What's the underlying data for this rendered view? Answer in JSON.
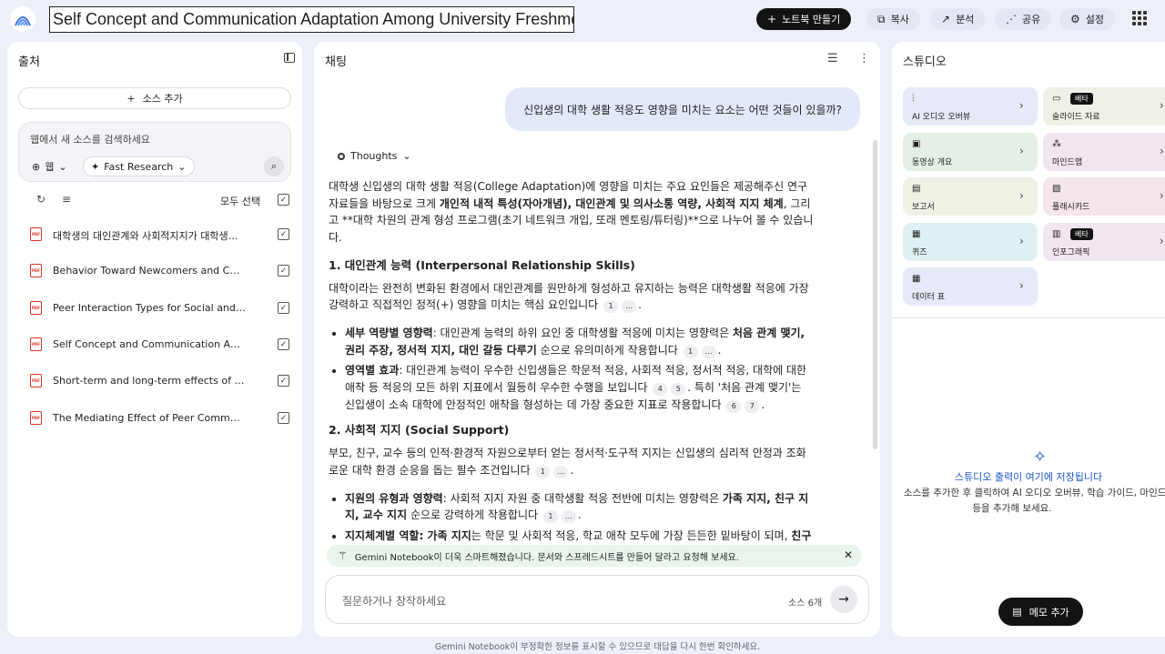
{
  "header": {
    "title": "Self Concept and Communication Adaptation Among University Freshmen",
    "create_notebook": "노트북 만들기",
    "copy": "복사",
    "analytics": "분석",
    "share": "공유",
    "settings": "설정"
  },
  "sources": {
    "panel_title": "출처",
    "add_source": "소스 추가",
    "search_placeholder": "웹에서 새 소스를 검색하세요",
    "chip_web": "웹",
    "chip_research": "Fast Research",
    "select_all": "모두 선택",
    "items": [
      "대학생의 대인관계와 사회적지지가 대학생활 적응에 미치는 영향",
      "Behavior Toward Newcomers and Contributions to Online Communities",
      "Peer Interaction Types for Social and Academic Adjustment",
      "Self Concept and Communication Adaptation Among University Freshmen",
      "Short-term and long-term effects of a social network intervention",
      "The Mediating Effect of Peer Communication on Adjustment"
    ]
  },
  "chat": {
    "panel_title": "채팅",
    "user_message": "신입생의 대학 생활 적응도 영향을 미치는 요소는 어떤 것들이 있을까?",
    "thoughts_label": "Thoughts",
    "intro_a": "대학생 신입생의 대학 생활 적응(College Adaptation)에 영향을 미치는 주요 요인들은 제공해주신 연구 자료들을 바탕으로 크게 ",
    "intro_b": "개인적 내적 특성(자아개념), 대인관계 및 의사소통 역량, 사회적 지지 체계",
    "intro_c": ", 그리고 **대학 차원의 관계 형성 프로그램(초기 네트워크 개입, 또래 멘토링/튜터링)**으로 나누어 볼 수 있습니다.",
    "s1_title": "1. 대인관계 능력 (Interpersonal Relationship Skills)",
    "s1_body": "대학이라는 완전히 변화된 환경에서 대인관계를 원만하게 형성하고 유지하는 능력은 대학생활 적응에 가장 강력하고 직접적인 정적(+) 영향을 미치는 핵심 요인입니다",
    "s1_b1_head": "세부 역량별 영향력",
    "s1_b1_a": ": 대인관계 능력의 하위 요인 중 대학생활 적응에 미치는 영향력은 ",
    "s1_b1_b": "처음 관계 맺기, 권리 주장, 정서적 지지, 대인 갈등 다루기",
    "s1_b1_c": " 순으로 유의미하게 작용합니다",
    "s1_b2_head": "영역별 효과",
    "s1_b2_a": ": 대인관계 능력이 우수한 신입생들은 학문적 적응, 사회적 적응, 정서적 적응, 대학에 대한 애착 등 적응의 모든 하위 지표에서 월등히 우수한 수행을 보입니다",
    "s1_b2_b": ". 특히 '처음 관계 맺기'는 신입생이 소속 대학에 안정적인 애착을 형성하는 데 가장 중요한 지표로 작용합니다",
    "s2_title": "2. 사회적 지지 (Social Support)",
    "s2_body": "부모, 친구, 교수 등의 인적·환경적 자원으로부터 얻는 정서적·도구적 지지는 신입생의 심리적 안정과 조화로운 대학 환경 순응을 돕는 필수 조건입니다",
    "s2_b1_head": "지원의 유형과 영향력",
    "s2_b1_a": ": 사회적 지지 자원 중 대학생활 적응 전반에 미치는 영향력은 ",
    "s2_b1_b": "가족 지지, 친구 지지, 교수 지지",
    "s2_b1_c": " 순으로 강력하게 작용합니다",
    "s2_b2_head": "지지체계별 역할: 가족 지지",
    "s2_b2_a": "는 학문 및 사회적 적응, 학교 애착 모두에 가장 든든한 밑바탕이 되며, ",
    "s2_b2_b": "친구",
    "cite_1": "1",
    "cite_more": "…",
    "cite_4": "4",
    "cite_5": "5",
    "cite_6": "6",
    "cite_7": "7",
    "banner": "Gemini Notebook이 더욱 스마트해졌습니다. 문서와 스프레드시트를 만들어 달라고 요청해 보세요.",
    "input_placeholder": "질문하거나 창작하세요",
    "source_count": "소스 6개"
  },
  "studio": {
    "panel_title": "스튜디오",
    "beta": "베타",
    "cards": [
      {
        "label": "AI 오디오 오버뷰",
        "color": "#e6e9f7"
      },
      {
        "label": "슬라이드 자료",
        "color": "#f1f0e6"
      },
      {
        "label": "동영상 개요",
        "color": "#e4f0e6"
      },
      {
        "label": "마인드맵",
        "color": "#f1e6ef"
      },
      {
        "label": "보고서",
        "color": "#f1f0e4"
      },
      {
        "label": "플래시카드",
        "color": "#f3e5ea"
      },
      {
        "label": "퀴즈",
        "color": "#dff0f3"
      },
      {
        "label": "인포그래픽",
        "color": "#f1e6ef"
      },
      {
        "label": "데이터 표",
        "color": "#e6e9f7"
      }
    ],
    "empty_title": "스튜디오 출력이 여기에 저장됩니다",
    "empty_desc_1": "소스를 추가한 후 클릭하여 AI 오디오 오버뷰, 학습 가이드, 마인드맵",
    "empty_desc_2": "등을 추가해 보세요.",
    "memo_button": "메모 추가"
  },
  "footer": {
    "disclaimer": "Gemini Notebook이 부정확한 정보를 표시할 수 있으므로 대답을 다시 한번 확인하세요."
  }
}
